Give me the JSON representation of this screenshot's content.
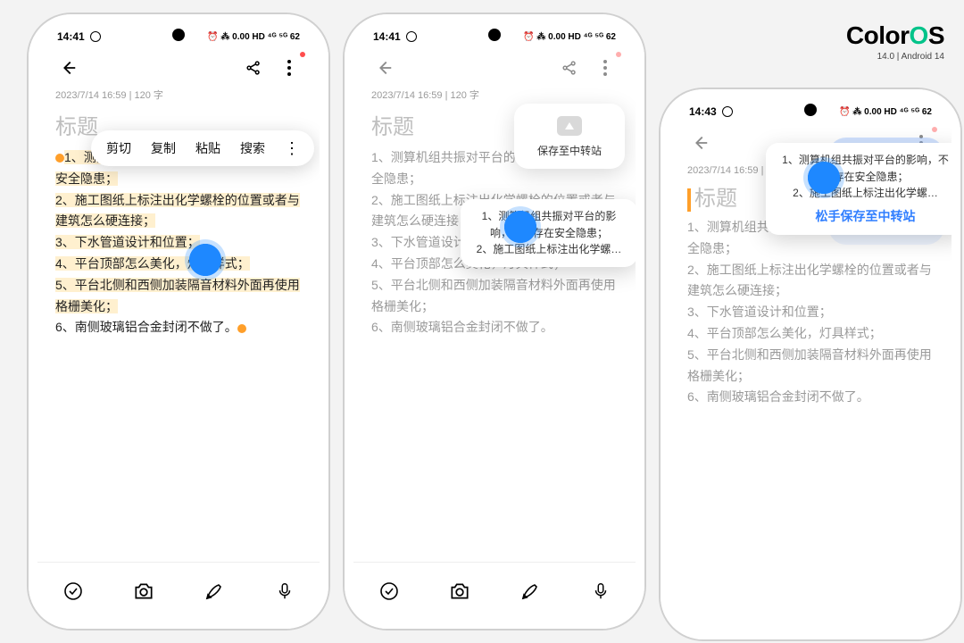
{
  "brand": {
    "logo_a": "Color",
    "logo_b": "O",
    "logo_c": "S",
    "sub": "14.0 | Android 14"
  },
  "status": {
    "time1": "14:41",
    "time3": "14:43",
    "right": "⏰ ⁂ 0.00 HD ⁴ᴳ ⁵ᴳ 62"
  },
  "meta": {
    "text": "2023/7/14 16:59  |  120 字"
  },
  "title": "标题",
  "ctx": {
    "cut": "剪切",
    "copy": "复制",
    "paste": "粘贴",
    "search": "搜索"
  },
  "pop_relay": "保存至中转站",
  "drag_hint": "松手保存至中转站",
  "note": {
    "l1": "1、测算机组共振对平台的影响，不要存在安全隐患；",
    "l2": "2、施工图纸上标注出化学螺栓的位置或者与建筑怎么硬连接；",
    "l3": "3、下水管道设计和位置；",
    "l4": "4、平台顶部怎么美化，灯具样式；",
    "l5": "5、平台北侧和西侧加装隔音材料外面再使用格栅美化；",
    "l6": "6、南侧玻璃铝合金封闭不做了。"
  },
  "note_p1": {
    "hl1": "1、测算机组共振对平台的影响，不要存在安全隐患；",
    "hl2a": "2、施工图纸上标注出化学螺栓的位置或者与建筑怎么硬连接；",
    "hl3": "3、下水管道设计和位置；",
    "hl4": "4、平台顶部怎么美化，灯具样式；",
    "hl5": "5、平台北侧和西侧加装隔音材料外面再使用格栅美化；",
    "l6a": "6、南侧玻璃铝合金封闭不做了",
    "l6b": "。"
  },
  "note_p2": {
    "l1": "1、测算机组共振对平台的影响，不要存在安全隐患；",
    "l2": "2、施工图纸上标注出化学螺栓的位置或者与建筑怎么硬连接；",
    "l3": "3、下水管道设计和位置；"
  },
  "drag2": {
    "a": "1、测算机组共振对平台的影响，不要存在安全隐患；",
    "b": "2、施工图纸上标注出化学螺…"
  },
  "drag3": {
    "a": "1、测算机组共振对平台的影响，不要存在安全隐患；",
    "b": "2、施工图纸上标注出化学螺…"
  }
}
